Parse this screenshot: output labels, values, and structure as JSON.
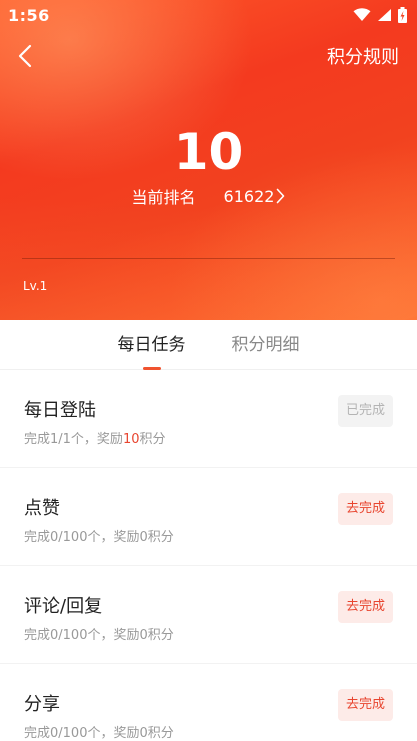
{
  "status_bar": {
    "time": "1:56"
  },
  "nav": {
    "rules_label": "积分规则"
  },
  "points": {
    "score": "10",
    "rank_label": "当前排名",
    "rank_value": "61622",
    "level": "Lv.1"
  },
  "tabs": [
    {
      "label": "每日任务",
      "active": true
    },
    {
      "label": "积分明细",
      "active": false
    }
  ],
  "tasks": [
    {
      "title": "每日登陆",
      "desc_prefix": "完成1/1个，奖励",
      "desc_points": "10",
      "desc_suffix": "积分",
      "button": "已完成",
      "status": "done"
    },
    {
      "title": "点赞",
      "desc_prefix": "完成0/100个，奖励",
      "desc_points": "0",
      "desc_suffix": "积分",
      "button": "去完成",
      "status": "todo"
    },
    {
      "title": "评论/回复",
      "desc_prefix": "完成0/100个，奖励",
      "desc_points": "0",
      "desc_suffix": "积分",
      "button": "去完成",
      "status": "todo"
    },
    {
      "title": "分享",
      "desc_prefix": "完成0/100个，奖励",
      "desc_points": "0",
      "desc_suffix": "积分",
      "button": "去完成",
      "status": "todo"
    }
  ],
  "colors": {
    "accent": "#e8452f",
    "header": "#f43a1f"
  },
  "icons": {
    "back": "chevron-left-icon",
    "rank_arrow": "chevron-right-icon",
    "wifi": "wifi-icon",
    "signal": "signal-icon",
    "battery": "battery-icon"
  }
}
